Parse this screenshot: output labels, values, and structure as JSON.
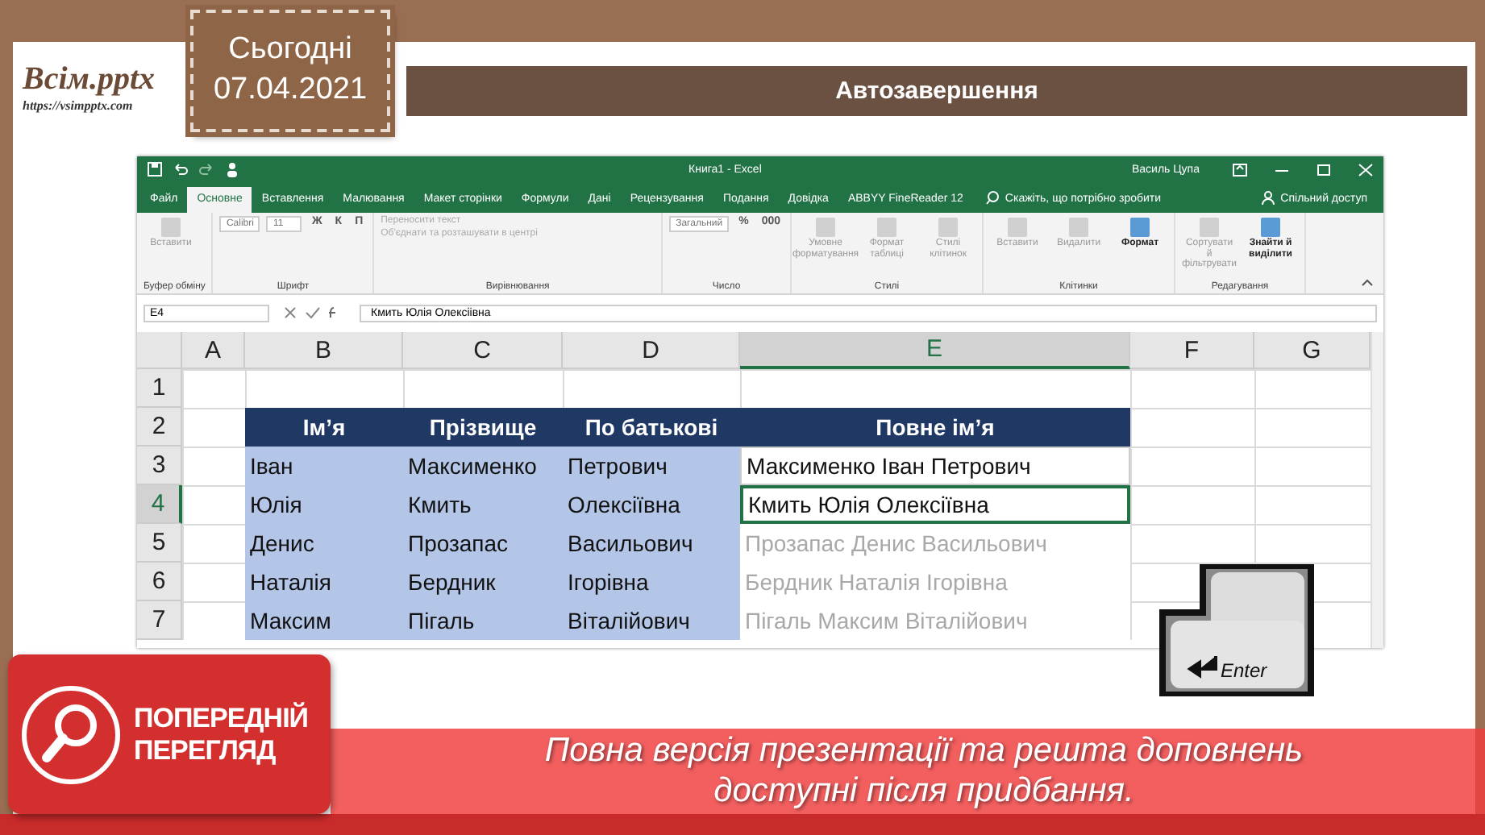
{
  "slide": {
    "logo": "Всім.pptx",
    "logo_url": "https://vsimpptx.com",
    "date_label": "Сьогодні",
    "date": "07.04.2021",
    "title": "Автозавершення"
  },
  "excel": {
    "title": "Книга1 - Excel",
    "user": "Василь Цупа",
    "tabs": [
      {
        "label": "Файл",
        "selected": false
      },
      {
        "label": "Основне",
        "selected": true
      },
      {
        "label": "Вставлення",
        "selected": false
      },
      {
        "label": "Малювання",
        "selected": false
      },
      {
        "label": "Макет сторінки",
        "selected": false
      },
      {
        "label": "Формули",
        "selected": false
      },
      {
        "label": "Дані",
        "selected": false
      },
      {
        "label": "Рецензування",
        "selected": false
      },
      {
        "label": "Подання",
        "selected": false
      },
      {
        "label": "Довідка",
        "selected": false
      },
      {
        "label": "ABBYY FineReader 12",
        "selected": false
      }
    ],
    "tell_me": "Скажіть, що потрібно зробити",
    "share": "Спільний доступ",
    "ribbon_groups": [
      {
        "label": "Буфер обміну",
        "items": [
          {
            "kind": "big",
            "text": "Вставити"
          }
        ]
      },
      {
        "label": "Шрифт",
        "items": [
          {
            "kind": "field",
            "text": "Calibri"
          },
          {
            "kind": "field",
            "text": "11"
          },
          {
            "kind": "small",
            "text": "Ж"
          },
          {
            "kind": "small",
            "text": "К"
          },
          {
            "kind": "small",
            "text": "П"
          }
        ]
      },
      {
        "label": "Вирівнювання",
        "items": [
          {
            "kind": "line",
            "text": "Переносити текст"
          },
          {
            "kind": "line",
            "text": "Об'єднати та розташувати в центрі"
          }
        ]
      },
      {
        "label": "Число",
        "items": [
          {
            "kind": "field",
            "text": "Загальний"
          },
          {
            "kind": "small",
            "text": "%"
          },
          {
            "kind": "small",
            "text": "000"
          }
        ]
      },
      {
        "label": "Стилі",
        "items": [
          {
            "kind": "big",
            "text": "Умовне форматування"
          },
          {
            "kind": "big",
            "text": "Формат таблиці"
          },
          {
            "kind": "big",
            "text": "Стилі клітинок"
          }
        ]
      },
      {
        "label": "Клітинки",
        "items": [
          {
            "kind": "big",
            "text": "Вставити"
          },
          {
            "kind": "big",
            "text": "Видалити"
          },
          {
            "kind": "bold",
            "text": "Формат"
          }
        ]
      },
      {
        "label": "Редагування",
        "items": [
          {
            "kind": "big",
            "text": "Сортувати й фільтрувати"
          },
          {
            "kind": "bold",
            "text": "Знайти й виділити"
          }
        ]
      }
    ],
    "name_box": "E4",
    "formula": "Кмить Юлія Олексіівна",
    "columns": [
      {
        "label": "A",
        "selected": false
      },
      {
        "label": "B",
        "selected": false
      },
      {
        "label": "C",
        "selected": false
      },
      {
        "label": "D",
        "selected": false
      },
      {
        "label": "E",
        "selected": true
      },
      {
        "label": "F",
        "selected": false
      },
      {
        "label": "G",
        "selected": false
      }
    ],
    "rows": [
      {
        "number": "1",
        "selected": false,
        "cells": [
          {
            "kind": "empty",
            "text": ""
          },
          {
            "kind": "empty",
            "text": ""
          },
          {
            "kind": "empty",
            "text": ""
          },
          {
            "kind": "empty",
            "text": ""
          },
          {
            "kind": "empty",
            "text": ""
          },
          {
            "kind": "empty",
            "text": ""
          },
          {
            "kind": "empty",
            "text": ""
          }
        ]
      },
      {
        "number": "2",
        "selected": false,
        "cells": [
          {
            "kind": "empty",
            "text": ""
          },
          {
            "kind": "header",
            "text": "Ім’я"
          },
          {
            "kind": "header",
            "text": "Прізвище"
          },
          {
            "kind": "header",
            "text": "По батькові"
          },
          {
            "kind": "header",
            "text": "Повне ім’я"
          },
          {
            "kind": "empty",
            "text": ""
          },
          {
            "kind": "empty",
            "text": ""
          }
        ]
      },
      {
        "number": "3",
        "selected": false,
        "cells": [
          {
            "kind": "empty",
            "text": ""
          },
          {
            "kind": "body",
            "text": "Іван"
          },
          {
            "kind": "body",
            "text": "Максименко"
          },
          {
            "kind": "body",
            "text": "Петрович"
          },
          {
            "kind": "filled",
            "text": "Максименко Іван Петрович"
          },
          {
            "kind": "empty",
            "text": ""
          },
          {
            "kind": "empty",
            "text": ""
          }
        ]
      },
      {
        "number": "4",
        "selected": true,
        "cells": [
          {
            "kind": "empty",
            "text": ""
          },
          {
            "kind": "body",
            "text": "Юлія"
          },
          {
            "kind": "body",
            "text": "Кмить"
          },
          {
            "kind": "body",
            "text": "Олексіївна"
          },
          {
            "kind": "active",
            "text": "Кмить Юлія Олексіївна"
          },
          {
            "kind": "empty",
            "text": ""
          },
          {
            "kind": "empty",
            "text": ""
          }
        ]
      },
      {
        "number": "5",
        "selected": false,
        "cells": [
          {
            "kind": "empty",
            "text": ""
          },
          {
            "kind": "body",
            "text": "Денис"
          },
          {
            "kind": "body",
            "text": "Прозапас"
          },
          {
            "kind": "body",
            "text": "Васильович"
          },
          {
            "kind": "suggested",
            "text": "Прозапас Денис Васильович"
          },
          {
            "kind": "empty",
            "text": ""
          },
          {
            "kind": "empty",
            "text": ""
          }
        ]
      },
      {
        "number": "6",
        "selected": false,
        "cells": [
          {
            "kind": "empty",
            "text": ""
          },
          {
            "kind": "body",
            "text": "Наталія"
          },
          {
            "kind": "body",
            "text": "Бердник"
          },
          {
            "kind": "body",
            "text": "Ігорівна"
          },
          {
            "kind": "suggested",
            "text": "Бердник Наталія Ігорівна"
          },
          {
            "kind": "empty",
            "text": ""
          },
          {
            "kind": "empty",
            "text": ""
          }
        ]
      },
      {
        "number": "7",
        "selected": false,
        "cells": [
          {
            "kind": "empty",
            "text": ""
          },
          {
            "kind": "body",
            "text": "Максим"
          },
          {
            "kind": "body",
            "text": "Пігаль"
          },
          {
            "kind": "body",
            "text": "Віталійович"
          },
          {
            "kind": "suggested",
            "text": "Пігаль Максим Віталійович"
          },
          {
            "kind": "empty",
            "text": ""
          },
          {
            "kind": "empty",
            "text": ""
          }
        ]
      }
    ]
  },
  "enter_key": {
    "label": "Enter"
  },
  "preview_banner": {
    "badge": [
      "ПОПЕРЕДНІЙ",
      "ПЕРЕГЛЯД"
    ],
    "message": [
      "Повна версія презентації та решта доповнень",
      "доступні після придбання."
    ]
  }
}
